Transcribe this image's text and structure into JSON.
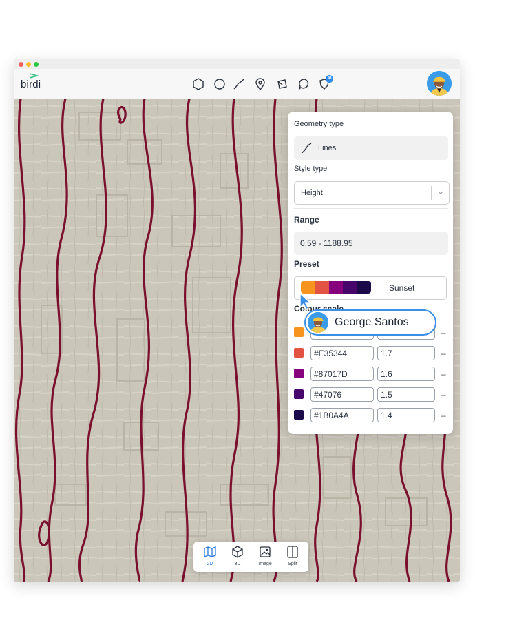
{
  "app": {
    "logo_text": "birdi",
    "brand_color": "#2ec27e",
    "accent_color": "#2d8cf0",
    "contour_color": "#7a0f2e"
  },
  "toolbar": {
    "tools": [
      {
        "icon": "polygon-icon"
      },
      {
        "icon": "circle-icon"
      },
      {
        "icon": "line-icon"
      },
      {
        "icon": "pin-icon"
      },
      {
        "icon": "pen-icon"
      },
      {
        "icon": "comment-icon"
      },
      {
        "icon": "ai-shield-icon",
        "badge": "AI"
      }
    ]
  },
  "style_panel": {
    "geometry_type_label": "Geometry type",
    "geometry_type_value": "Lines",
    "style_type_label": "Style type",
    "style_type_value": "Height",
    "range_label": "Range",
    "range_value": "0.59 - 1188.95",
    "preset_label": "Preset",
    "preset_value": "Sunset",
    "colour_scale_label": "Colour scale",
    "colour_scale": [
      {
        "color": "#F7941D",
        "hex": "",
        "value": ""
      },
      {
        "color": "#E35344",
        "hex": "#E35344",
        "value": "1.7"
      },
      {
        "color": "#87017D",
        "hex": "#87017D",
        "value": "1.6"
      },
      {
        "color": "#47076",
        "hex": "#47076",
        "value": "1.5"
      },
      {
        "color": "#1B0A4A",
        "hex": "#1B0A4A",
        "value": "1.4"
      }
    ],
    "remove_symbol": "–"
  },
  "presence": {
    "user_name": "George Santos"
  },
  "view_modes": [
    {
      "label": "2D",
      "icon": "map-icon",
      "active": true
    },
    {
      "label": "3D",
      "icon": "cube-icon",
      "active": false
    },
    {
      "label": "Image",
      "icon": "image-icon",
      "active": false
    },
    {
      "label": "Split",
      "icon": "split-icon",
      "active": false
    }
  ]
}
